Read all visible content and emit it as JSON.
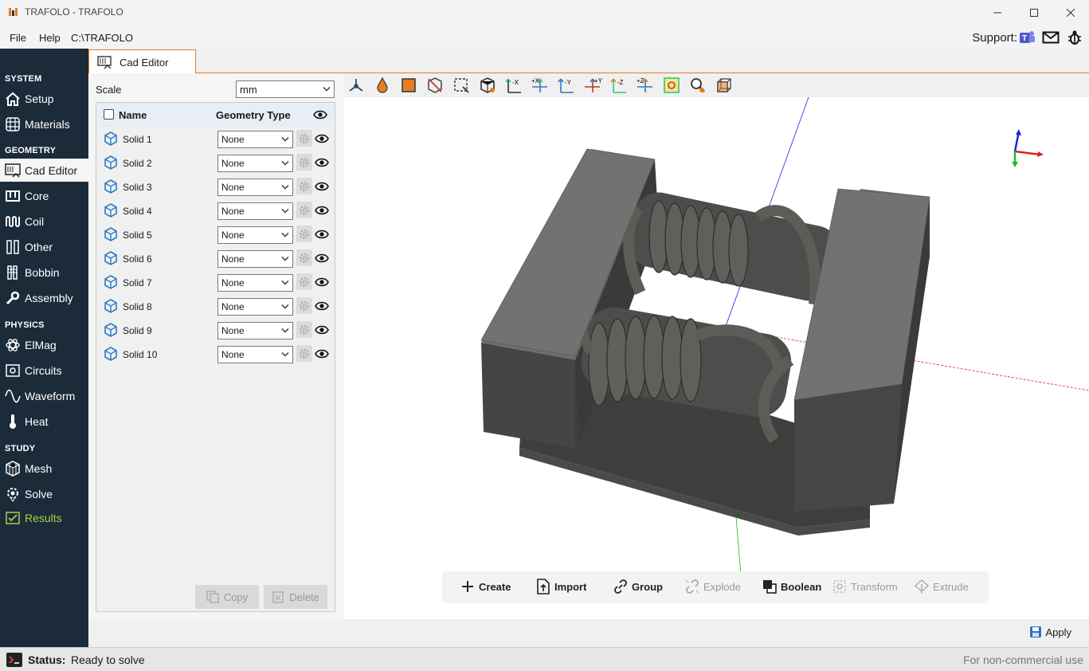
{
  "window": {
    "title": "TRAFOLO - TRAFOLO"
  },
  "menu": {
    "file": "File",
    "help": "Help",
    "path": "C:\\TRAFOLO"
  },
  "support": {
    "label": "Support:"
  },
  "sidebar": {
    "sections": {
      "system": "SYSTEM",
      "geometry": "GEOMETRY",
      "physics": "PHYSICS",
      "study": "STUDY"
    },
    "items": {
      "setup": "Setup",
      "materials": "Materials",
      "cad_editor": "Cad Editor",
      "core": "Core",
      "coil": "Coil",
      "other": "Other",
      "bobbin": "Bobbin",
      "assembly": "Assembly",
      "elmag": "ElMag",
      "circuits": "Circuits",
      "waveform": "Waveform",
      "heat": "Heat",
      "mesh": "Mesh",
      "solve": "Solve",
      "results": "Results"
    }
  },
  "tab": {
    "label": "Cad Editor"
  },
  "panel": {
    "scale_label": "Scale",
    "scale_value": "mm",
    "headers": {
      "name": "Name",
      "geometry_type": "Geometry Type"
    },
    "solids": [
      {
        "name": "Solid 1",
        "type": "None"
      },
      {
        "name": "Solid 2",
        "type": "None"
      },
      {
        "name": "Solid 3",
        "type": "None"
      },
      {
        "name": "Solid 4",
        "type": "None"
      },
      {
        "name": "Solid 5",
        "type": "None"
      },
      {
        "name": "Solid 6",
        "type": "None"
      },
      {
        "name": "Solid 7",
        "type": "None"
      },
      {
        "name": "Solid 8",
        "type": "None"
      },
      {
        "name": "Solid 9",
        "type": "None"
      },
      {
        "name": "Solid 10",
        "type": "None"
      }
    ],
    "copy": "Copy",
    "delete": "Delete"
  },
  "toolbar": {
    "axis_labels": [
      "-X",
      "+X",
      "-Y",
      "+Y",
      "-Z",
      "+Z"
    ]
  },
  "actions": {
    "create": "Create",
    "import": "Import",
    "group": "Group",
    "explode": "Explode",
    "boolean": "Boolean",
    "transform": "Transform",
    "extrude": "Extrude"
  },
  "apply": "Apply",
  "status": {
    "label": "Status:",
    "value": "Ready to solve",
    "license": "For non-commercial use"
  },
  "colors": {
    "sidebar_bg": "#1c2b3a",
    "accent": "#e67e22",
    "results_green": "#a6d04e",
    "model_gray": "#5c5c58",
    "icon_blue": "#2e7bc4"
  }
}
